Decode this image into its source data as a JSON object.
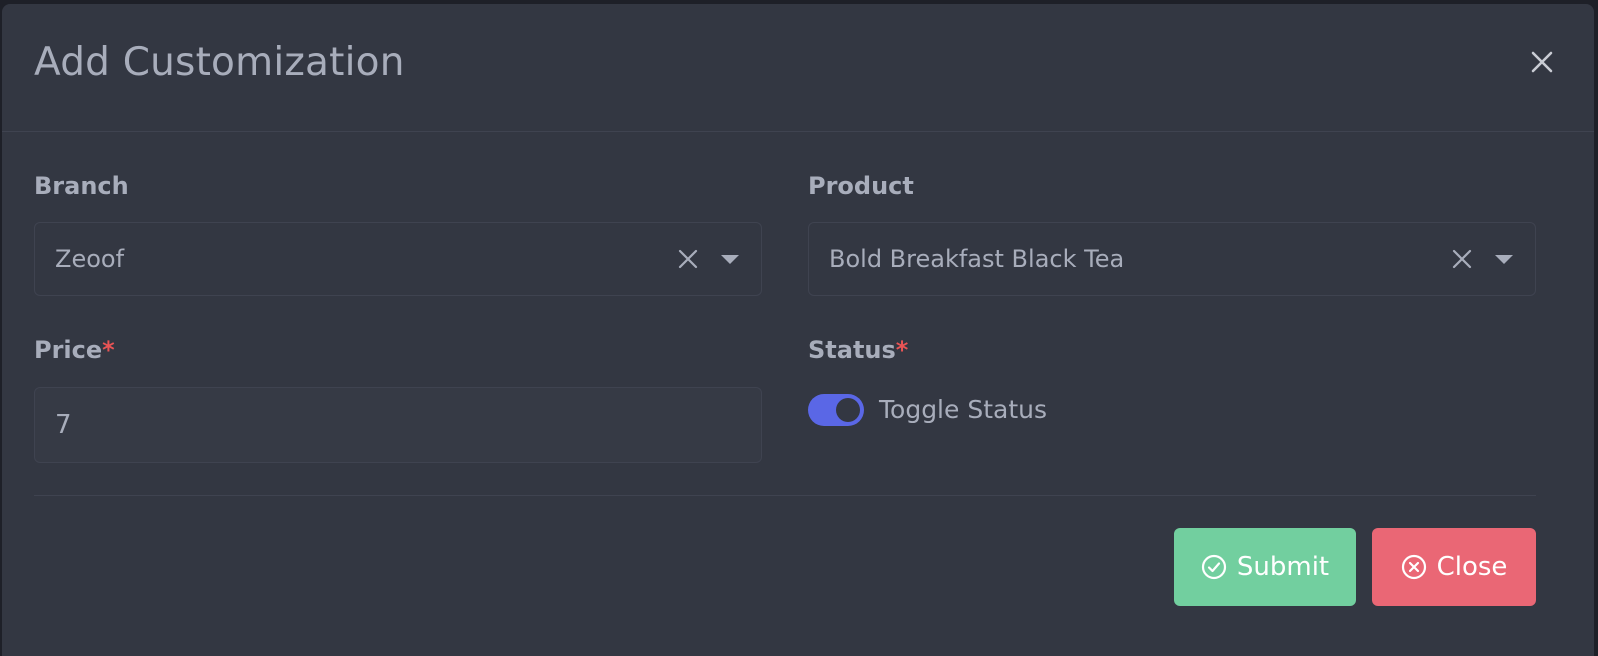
{
  "modal": {
    "title": "Add Customization"
  },
  "form": {
    "branch": {
      "label": "Branch",
      "value": "Zeoof"
    },
    "product": {
      "label": "Product",
      "value": "Bold Breakfast Black Tea"
    },
    "price": {
      "label": "Price",
      "required_mark": "*",
      "value": "7"
    },
    "status": {
      "label": "Status",
      "required_mark": "*",
      "toggle_label": "Toggle Status",
      "enabled": true
    }
  },
  "footer": {
    "submit_label": "Submit",
    "close_label": "Close"
  },
  "colors": {
    "modal_bg": "#333742",
    "text": "#a8adbb",
    "required": "#ea5455",
    "toggle_on": "#5a67e6",
    "submit": "#72cf9f",
    "close": "#ea6775"
  },
  "icons": {
    "header_close": "close-icon",
    "clear": "clear-icon",
    "dropdown": "chevron-down-icon",
    "submit": "check-circle-icon",
    "close": "x-circle-icon"
  }
}
